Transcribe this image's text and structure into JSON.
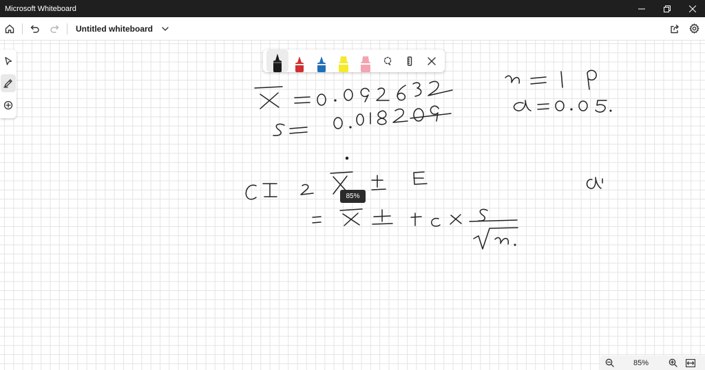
{
  "window": {
    "title": "Microsoft Whiteboard",
    "controls": [
      "minimize-icon",
      "restore-icon",
      "close-icon"
    ]
  },
  "appbar": {
    "board_title": "Untitled whiteboard",
    "icons": [
      "home-icon",
      "undo-icon",
      "redo-icon",
      "chevron-down-icon",
      "share-icon",
      "settings-icon"
    ]
  },
  "left_toolbar": {
    "tools": [
      "select-icon",
      "pen-icon",
      "add-icon"
    ],
    "active_tool": "pen-icon"
  },
  "pen_tray": {
    "pens": [
      {
        "name": "black-pen",
        "color": "#1a1a1a",
        "selected": true
      },
      {
        "name": "red-pen",
        "color": "#d32f2f"
      },
      {
        "name": "blue-pen",
        "color": "#1f6fb8"
      },
      {
        "name": "yellow-highlighter",
        "color": "#f5ea2a"
      },
      {
        "name": "pink-highlighter",
        "color": "#f4a3b0"
      }
    ],
    "icons": [
      "lasso-icon",
      "ruler-icon",
      "close-icon"
    ]
  },
  "canvas": {
    "zoom_tooltip": "85%"
  },
  "zoom_bar": {
    "zoom_level": "85%",
    "icons": [
      "zoom-out-icon",
      "zoom-in-icon",
      "fit-to-screen-icon"
    ]
  },
  "ink_text": {
    "line1": "X̄ = 0.092632",
    "line2": "s = 0.018209",
    "line3": "n = 19",
    "line4": "α = 0.05",
    "line5": "CI = X̄ ± E",
    "line6": "= X̄ ± tc × s/√n"
  }
}
